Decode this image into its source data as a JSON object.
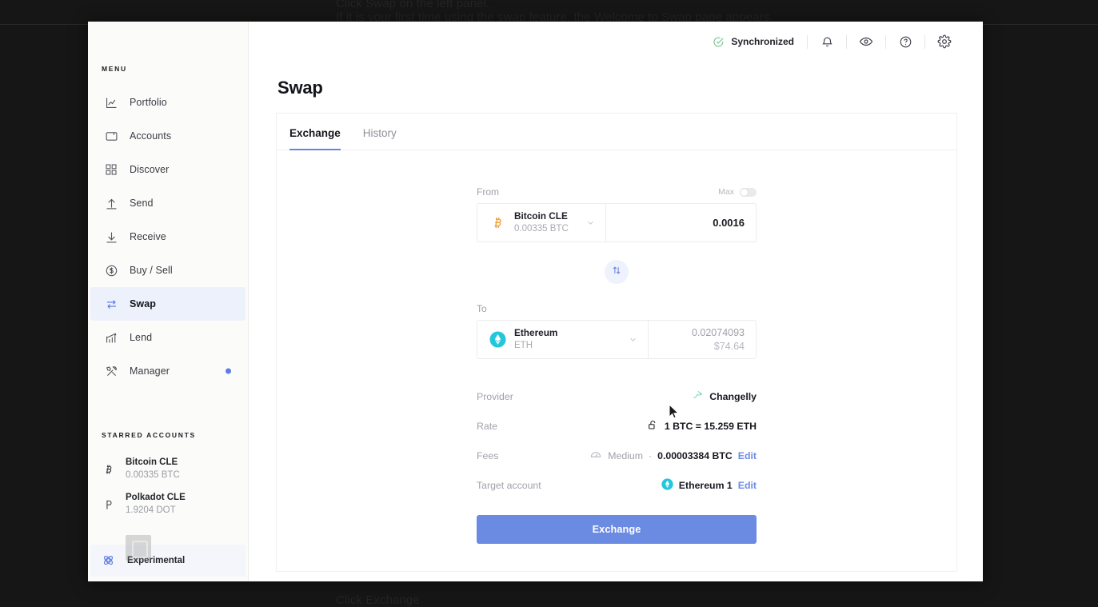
{
  "background": {
    "lines": [
      {
        "text": "Click Swap on the left panel.",
        "bold": "Swap"
      },
      {
        "text": "If it is your first time using the swap feature, the Welcome to Swap page appears."
      },
      {
        "text": "Click Exchange."
      }
    ]
  },
  "sidebar": {
    "menu_label": "MENU",
    "items": [
      {
        "label": "Portfolio",
        "icon": "chart-line-icon",
        "active": false,
        "badge": false
      },
      {
        "label": "Accounts",
        "icon": "wallet-icon",
        "active": false,
        "badge": false
      },
      {
        "label": "Discover",
        "icon": "grid-icon",
        "active": false,
        "badge": false
      },
      {
        "label": "Send",
        "icon": "arrow-up-icon",
        "active": false,
        "badge": false
      },
      {
        "label": "Receive",
        "icon": "arrow-down-icon",
        "active": false,
        "badge": false
      },
      {
        "label": "Buy / Sell",
        "icon": "dollar-circle-icon",
        "active": false,
        "badge": false
      },
      {
        "label": "Swap",
        "icon": "swap-arrows-icon",
        "active": true,
        "badge": false
      },
      {
        "label": "Lend",
        "icon": "growth-chart-icon",
        "active": false,
        "badge": false
      },
      {
        "label": "Manager",
        "icon": "tools-icon",
        "active": false,
        "badge": true
      }
    ],
    "starred_label": "STARRED ACCOUNTS",
    "accounts": [
      {
        "name": "Bitcoin CLE",
        "balance": "0.00335 BTC",
        "icon": "bitcoin-icon"
      },
      {
        "name": "Polkadot CLE",
        "balance": "1.9204 DOT",
        "icon": "polkadot-icon"
      }
    ],
    "experimental_label": "Experimental",
    "experimental_icon": "atom-icon"
  },
  "topbar": {
    "sync_label": "Synchronized",
    "sync_icon": "check-circle-icon",
    "buttons": [
      {
        "name": "bell-icon"
      },
      {
        "name": "eye-icon"
      },
      {
        "name": "help-circle-icon"
      },
      {
        "name": "gear-icon"
      }
    ]
  },
  "page": {
    "title": "Swap",
    "tabs": [
      {
        "label": "Exchange",
        "active": true
      },
      {
        "label": "History",
        "active": false
      }
    ]
  },
  "swap": {
    "from": {
      "label": "From",
      "max_label": "Max",
      "max_on": false,
      "coin_name": "Bitcoin CLE",
      "coin_sub": "0.00335 BTC",
      "coin_icon": "bitcoin-icon",
      "amount": "0.0016",
      "amount_placeholder": "0"
    },
    "switch_icon": "up-down-arrows-icon",
    "to": {
      "label": "To",
      "coin_name": "Ethereum",
      "coin_sub": "ETH",
      "coin_icon": "ethereum-icon",
      "amount": "0.02074093",
      "fiat": "$74.64"
    },
    "details": [
      {
        "label": "Provider",
        "icon": "changelly-logo-icon",
        "value": "Changelly",
        "edit": ""
      },
      {
        "label": "Rate",
        "icon": "unlock-icon",
        "value": "1 BTC = 15.259 ETH",
        "edit": ""
      },
      {
        "label": "Fees",
        "icon": "gauge-icon",
        "speed": "Medium",
        "separator": "·",
        "value": "0.00003384 BTC",
        "edit": "Edit"
      },
      {
        "label": "Target account",
        "icon": "ethereum-icon",
        "value": "Ethereum 1",
        "edit": "Edit"
      }
    ],
    "exchange_button": "Exchange"
  },
  "colors": {
    "accent": "#6b8ae2",
    "sidebar_active_bg": "#edf1fb",
    "sync_green": "#6fbf8b",
    "bitcoin_orange": "#f2a33c",
    "ethereum_teal": "#26c6da",
    "desktop_bg": "#161616"
  }
}
